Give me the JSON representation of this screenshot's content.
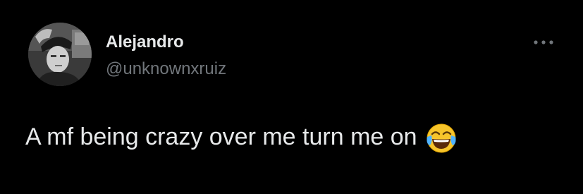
{
  "tweet": {
    "author": {
      "display_name": "Alejandro",
      "handle": "@unknownxruiz",
      "avatar_icon": "profile-photo"
    },
    "more_icon": "more-horizontal-icon",
    "text": "A mf being crazy over me turn me on",
    "emoji": "face-with-tears-of-joy",
    "colors": {
      "background": "#000000",
      "primary_text": "#e7e9ea",
      "secondary_text": "#71767b"
    }
  }
}
